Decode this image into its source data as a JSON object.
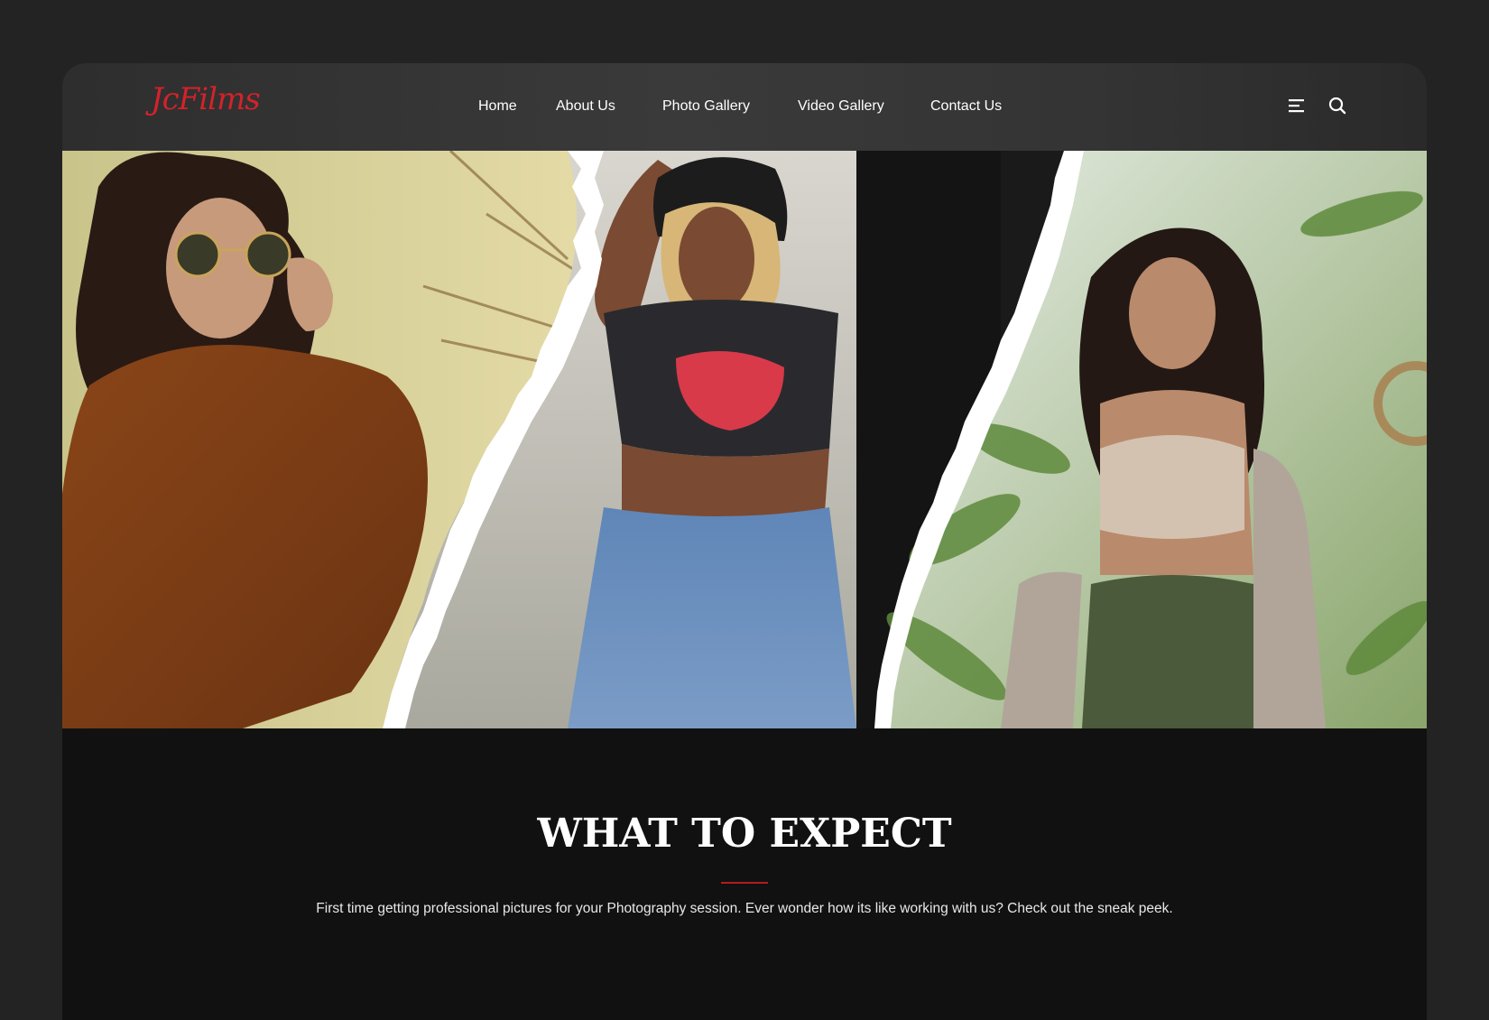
{
  "header": {
    "logo_text": "JcFilms",
    "nav": [
      {
        "label": "Home"
      },
      {
        "label": "About Us"
      },
      {
        "label": "Photo Gallery"
      },
      {
        "label": "Video Gallery"
      },
      {
        "label": "Contact Us"
      }
    ],
    "icons": [
      "menu-icon",
      "search-icon"
    ]
  },
  "hero": {
    "panels": [
      "left-photo",
      "center-photo",
      "right-photo"
    ]
  },
  "section": {
    "title": "WHAT TO EXPECT",
    "text": "First time getting professional pictures for your Photography session. Ever wonder how its like working with us? Check out the sneak peek."
  },
  "colors": {
    "accent": "#d4222a",
    "page_background": "#232323",
    "content_background": "#111111",
    "header_background": "#363636"
  }
}
